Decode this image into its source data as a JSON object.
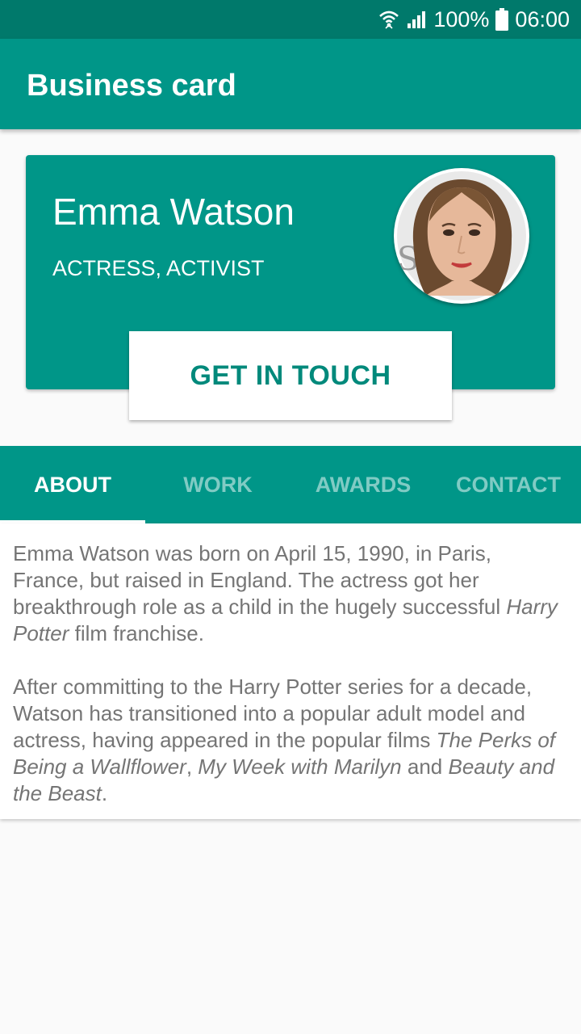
{
  "status_bar": {
    "battery": "100%",
    "time": "06:00",
    "icons": [
      "wifi-icon",
      "signal-icon",
      "battery-icon"
    ],
    "color": "#00796b"
  },
  "app_bar": {
    "title": "Business card",
    "color": "#009688"
  },
  "card": {
    "name": "Emma Watson",
    "role": "ACTRESS, ACTIVIST",
    "avatar_icon": "profile-photo",
    "cta_label": "GET IN TOUCH",
    "accent_text_color": "#00897b"
  },
  "tabs": [
    {
      "label": "ABOUT",
      "active": true
    },
    {
      "label": "WORK",
      "active": false
    },
    {
      "label": "AWARDS",
      "active": false
    },
    {
      "label": "CONTACT",
      "active": false
    }
  ],
  "about": {
    "p1": {
      "a": "Emma Watson was born on April 15, 1990, in Paris, France, but raised in England. The actress got her breakthrough role as a child in the hugely successful ",
      "b": "Harry Potter",
      "c": " film franchise."
    },
    "p2": {
      "a": "After committing to the Harry Potter series for a decade, Watson has transitioned into a popular adult model and actress, having appeared in the popular films ",
      "b": "The Perks of Being a Wallflower",
      "c": ", ",
      "d": "My Week with Marilyn",
      "e": " and ",
      "f": "Beauty and the Beast",
      "g": "."
    }
  }
}
